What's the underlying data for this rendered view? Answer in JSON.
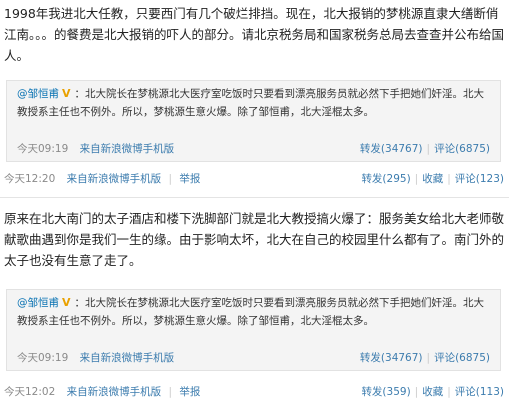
{
  "posts": [
    {
      "text": "1998年我进北大任教，只要西门有几个破烂排挡。现在，北大报销的梦桃源直隶大缮断俏江南。。。的餐费是北大报销的吓人的部分。请北京税务局和国家税务总局去查查并公布给国人。",
      "repost": {
        "user": "@邹恒甫",
        "badge": "V",
        "text": "：北大院长在梦桃源北大医疗室吃饭时只要看到漂亮服务员就必然下手把她们奸淫。北大教授系主任也不例外。所以，梦桃源生意火爆。除了邹恒甫，北大淫棍太多。",
        "time": "今天09:19",
        "source": "来自新浪微博手机版",
        "forward": "转发(34767)",
        "comment": "评论(6875)"
      },
      "time": "今天12:20",
      "source": "来自新浪微博手机版",
      "report": "举报",
      "forward": "转发(295)",
      "favorite": "收藏",
      "comment": "评论(123)"
    },
    {
      "text": "原来在北大南门的太子酒店和楼下洗脚部门就是北大教授搞火爆了：服务美女给北大老师敬献歌曲遇到你是我们一生的缘。由于影响太坏，北大在自己的校园里什么都有了。南门外的太子也没有生意了走了。",
      "repost": {
        "user": "@邹恒甫",
        "badge": "V",
        "text": "：北大院长在梦桃源北大医疗室吃饭时只要看到漂亮服务员就必然下手把她们奸淫。北大教授系主任也不例外。所以，梦桃源生意火爆。除了邹恒甫，北大淫棍太多。",
        "time": "今天09:19",
        "source": "来自新浪微博手机版",
        "forward": "转发(34767)",
        "comment": "评论(6875)"
      },
      "time": "今天12:02",
      "source": "来自新浪微博手机版",
      "report": "举报",
      "forward": "转发(359)",
      "favorite": "收藏",
      "comment": "评论(113)"
    }
  ]
}
